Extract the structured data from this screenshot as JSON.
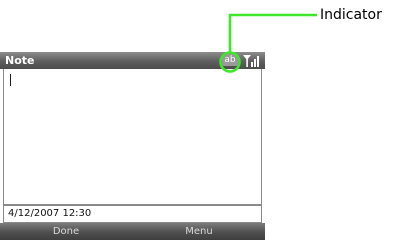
{
  "window": {
    "title": "Note"
  },
  "status": {
    "input_mode": "ab",
    "signal_icon": "signal-strength-icon"
  },
  "editor": {
    "text": ""
  },
  "footer": {
    "datetime": "4/12/2007 12:30"
  },
  "softkeys": {
    "left": "Done",
    "right": "Menu"
  },
  "callout": {
    "label": "Indicator"
  },
  "colors": {
    "highlight": "#3fe62b",
    "bar_dark": "#4f4f4f"
  }
}
